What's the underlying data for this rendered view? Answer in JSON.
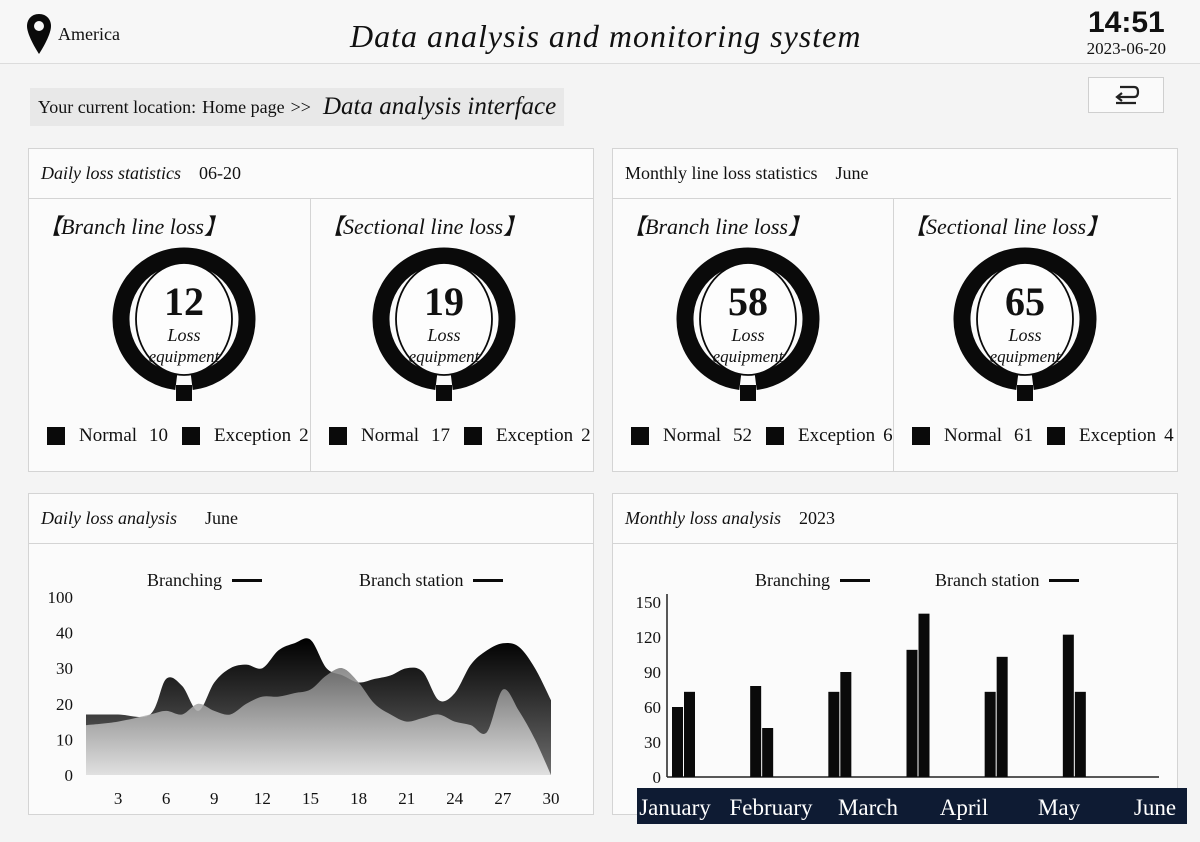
{
  "header": {
    "region": "America",
    "title": "Data analysis and monitoring system",
    "time": "14:51",
    "date": "2023-06-20"
  },
  "breadcrumb": {
    "prefix": "Your current location:",
    "home": "Home page",
    "separator": ">>",
    "current": "Data analysis interface"
  },
  "daily_stats": {
    "title": "Daily loss statistics",
    "period": "06-20",
    "branch": {
      "title": "【Branch line loss】",
      "count": "12",
      "label1": "Loss",
      "label2": "equipment",
      "normal_label": "Normal",
      "normal_value": "10",
      "exception_label": "Exception",
      "exception_value": "2"
    },
    "sectional": {
      "title": "【Sectional line loss】",
      "count": "19",
      "label1": "Loss",
      "label2": "equipment",
      "normal_label": "Normal",
      "normal_value": "17",
      "exception_label": "Exception",
      "exception_value": "2"
    }
  },
  "monthly_stats": {
    "title": "Monthly line loss statistics",
    "period": "June",
    "branch": {
      "title": "【Branch line loss】",
      "count": "58",
      "label1": "Loss",
      "label2": "equipment",
      "normal_label": "Normal",
      "normal_value": "52",
      "exception_label": "Exception",
      "exception_value": "6"
    },
    "sectional": {
      "title": "【Sectional line loss】",
      "count": "65",
      "label1": "Loss",
      "label2": "equipment",
      "normal_label": "Normal",
      "normal_value": "61",
      "exception_label": "Exception",
      "exception_value": "4"
    }
  },
  "daily_analysis": {
    "title": "Daily loss analysis",
    "period": "June",
    "legend_a": "Branching",
    "legend_b": "Branch station"
  },
  "monthly_analysis": {
    "title": "Monthly loss analysis",
    "period": "2023",
    "legend_a": "Branching",
    "legend_b": "Branch station"
  },
  "icons": {
    "location": "map-pin-icon",
    "back": "return-icon"
  },
  "colors": {
    "ink": "#0a0a0a",
    "month_bar": "#0e1b33"
  },
  "chart_data": [
    {
      "type": "area",
      "x": [
        1,
        3,
        5,
        6,
        7,
        8,
        9,
        10,
        11,
        12,
        13,
        14,
        15,
        16,
        17,
        18,
        19,
        20,
        21,
        22,
        23,
        24,
        25,
        26,
        27,
        28,
        29,
        30
      ],
      "x_ticks": [
        "3",
        "6",
        "9",
        "12",
        "15",
        "18",
        "21",
        "24",
        "27",
        "30"
      ],
      "y_ticks": [
        "0",
        "10",
        "20",
        "30",
        "40",
        "100"
      ],
      "series": [
        {
          "name": "Branching",
          "values": [
            17,
            17,
            17,
            27,
            25,
            18,
            26,
            30,
            31,
            30,
            35,
            37,
            38,
            30,
            28,
            26,
            27,
            28,
            30,
            29,
            21,
            23,
            31,
            35,
            37,
            36,
            30,
            21
          ]
        },
        {
          "name": "Branch station",
          "values": [
            14,
            15,
            17,
            18,
            17,
            20,
            18,
            17,
            20,
            22,
            22,
            23,
            24,
            28,
            30,
            26,
            20,
            17,
            15,
            16,
            17,
            15,
            14,
            12,
            24,
            18,
            10,
            0
          ]
        }
      ]
    },
    {
      "type": "bar",
      "categories": [
        "January",
        "February",
        "March",
        "April",
        "May",
        "June"
      ],
      "y_ticks": [
        "0",
        "30",
        "60",
        "90",
        "120",
        "150"
      ],
      "ylim": [
        0,
        150
      ],
      "series": [
        {
          "name": "Branching",
          "values": [
            60,
            78,
            73,
            109,
            73,
            122
          ]
        },
        {
          "name": "Branch station",
          "values": [
            73,
            42,
            90,
            140,
            103,
            73
          ]
        }
      ]
    }
  ]
}
